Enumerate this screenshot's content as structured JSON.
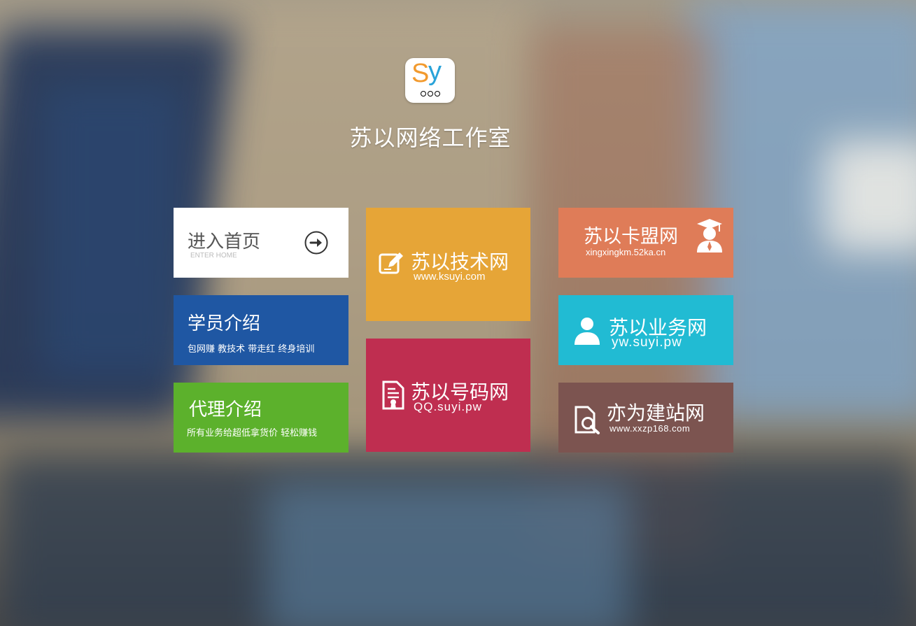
{
  "logo": {
    "letter_s": "S",
    "letter_y": "y"
  },
  "site_title": "苏以网络工作室",
  "tiles": {
    "home": {
      "title": "进入首页",
      "subtitle": "ENTER HOME",
      "icon": "arrow-right-circle-icon"
    },
    "student": {
      "title": "学员介绍",
      "desc": "包网赚 教技术 带走红 终身培训",
      "color": "#1f57a3"
    },
    "agent": {
      "title": "代理介绍",
      "desc": "所有业务给超低拿货价 轻松赚钱",
      "color": "#5cb12c"
    },
    "tech": {
      "title": "苏以技术网",
      "url": "www.ksuyi.com",
      "icon": "edit-icon",
      "color": "#e6a537"
    },
    "number": {
      "title": "苏以号码网",
      "url": "QQ.suyi.pw",
      "icon": "certificate-document-icon",
      "color": "#bf2e50"
    },
    "card": {
      "title": "苏以卡盟网",
      "url": "xingxingkm.52ka.cn",
      "icon": "graduate-icon",
      "color": "#df7c58"
    },
    "business": {
      "title": "苏以业务网",
      "url": "yw.suyi.pw",
      "icon": "user-icon",
      "color": "#21bbd3"
    },
    "site": {
      "title": "亦为建站网",
      "url": "www.xxzp168.com",
      "icon": "file-search-icon",
      "color": "#7c5450"
    }
  }
}
